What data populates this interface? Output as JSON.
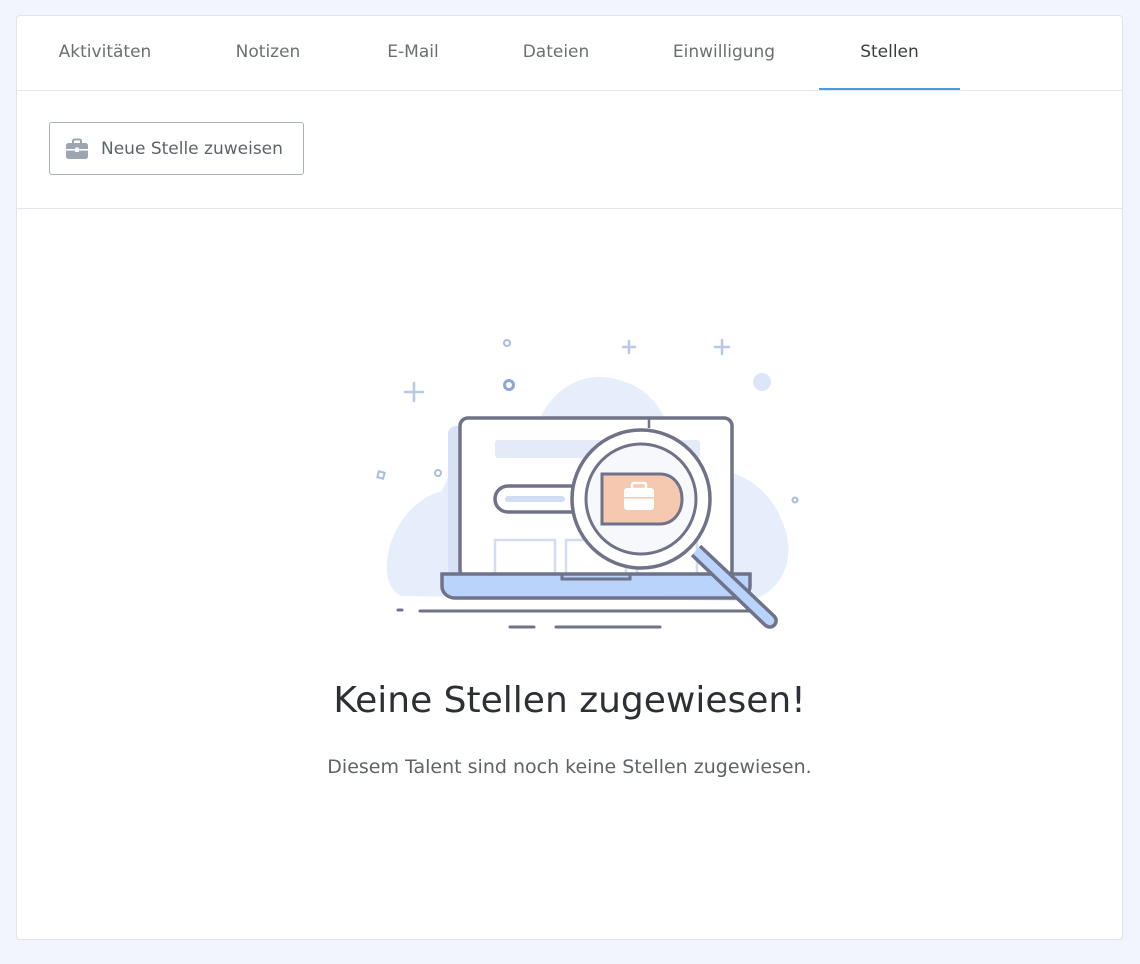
{
  "tabs": [
    {
      "label": "Aktivitäten",
      "active": false
    },
    {
      "label": "Notizen",
      "active": false
    },
    {
      "label": "E-Mail",
      "active": false
    },
    {
      "label": "Dateien",
      "active": false
    },
    {
      "label": "Einwilligung",
      "active": false
    },
    {
      "label": "Stellen",
      "active": true
    }
  ],
  "toolbar": {
    "assign_button_label": "Neue Stelle zuweisen",
    "assign_button_icon": "briefcase-icon"
  },
  "empty_state": {
    "title": "Keine Stellen zugewiesen!",
    "text": "Diesem Talent sind noch keine Stellen zugewiesen.",
    "illustration": "laptop-magnifier-briefcase-illustration"
  },
  "colors": {
    "active_tab_underline": "#4a9be0",
    "background": "#f2f5fd",
    "illustration_blue": "#b9d3fb",
    "illustration_peach": "#f4c9b0"
  }
}
